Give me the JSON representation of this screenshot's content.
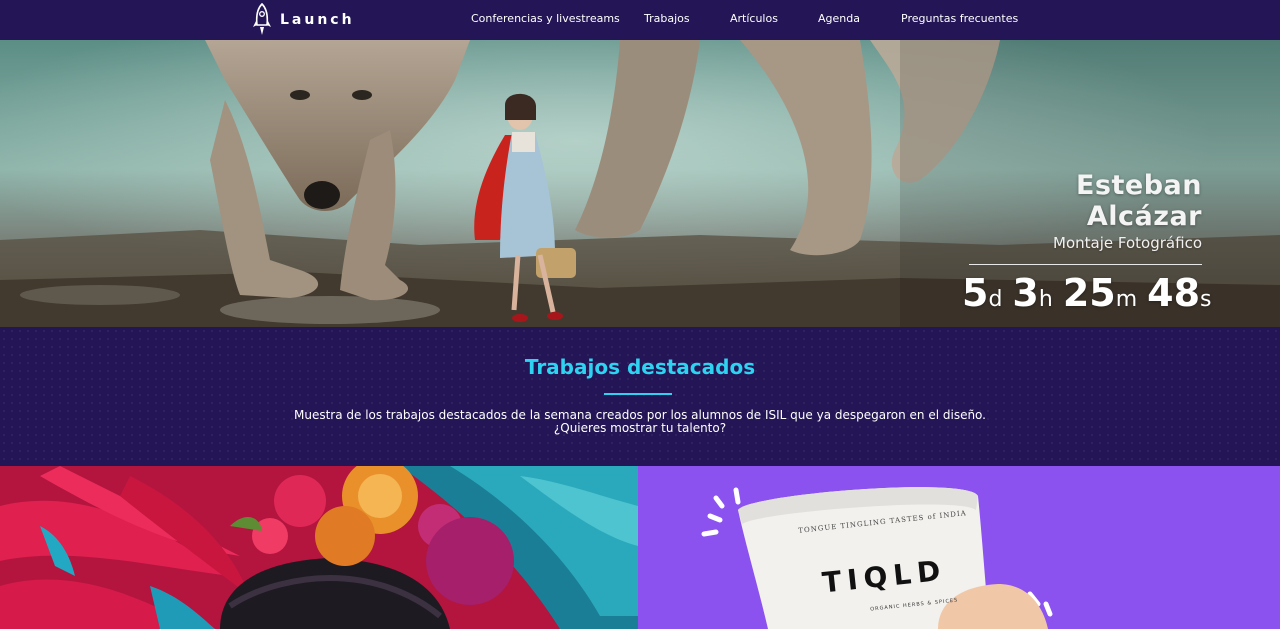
{
  "brand": {
    "name": "Launch",
    "icon": "rocket-icon"
  },
  "nav": {
    "links": [
      {
        "label": "Conferencias y livestreams"
      },
      {
        "label": "Trabajos"
      },
      {
        "label": "Artículos"
      },
      {
        "label": "Agenda"
      },
      {
        "label": "Preguntas frecuentes"
      }
    ]
  },
  "hero": {
    "name": "Esteban Alcázar",
    "subtitle": "Montaje Fotográfico",
    "countdown": {
      "days": "5",
      "days_unit": "d",
      "hours": "3",
      "hours_unit": "h",
      "minutes": "25",
      "minutes_unit": "m",
      "seconds": "48",
      "seconds_unit": "s"
    }
  },
  "featured": {
    "title": "Trabajos destacados",
    "description_line1": "Muestra de los trabajos destacados de la semana creados por los alumnos de ISIL que ya despegaron en el diseño.",
    "description_line2": "¿Quieres mostrar tu talento?"
  },
  "gallery": {
    "right_tile": {
      "pouch_tagline": "TONGUE TINGLING TASTES of INDIA",
      "pouch_brand": "TIQLD",
      "pouch_small": "ORGANIC HERBS & SPICES"
    }
  },
  "colors": {
    "nav_bg": "#241656",
    "accent": "#2fd3f2",
    "tile_purple": "#8b52ef"
  }
}
